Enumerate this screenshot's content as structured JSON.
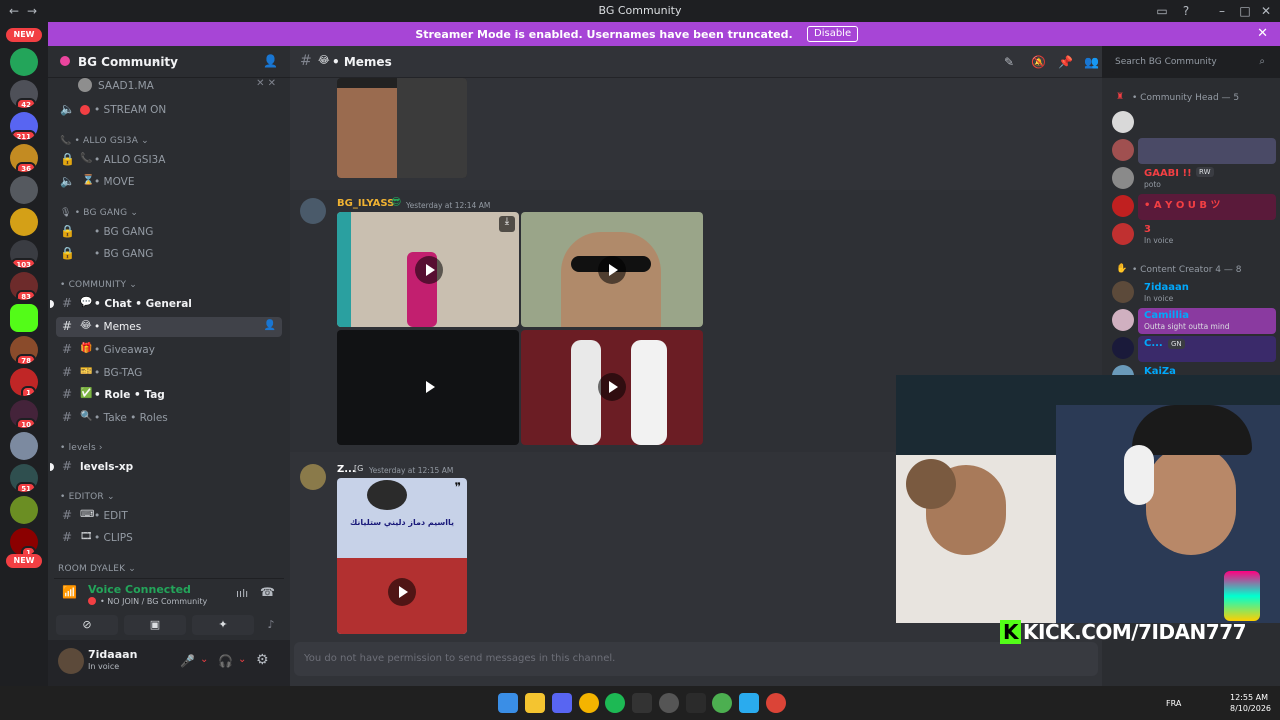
{
  "window": {
    "title": "BG Community"
  },
  "banner": {
    "text": "Streamer Mode is enabled. Usernames have been truncated.",
    "disable_label": "Disable"
  },
  "rail": {
    "new_top": "NEW",
    "new_bottom": "NEW",
    "badges": [
      "42",
      "211",
      "36",
      "103",
      "83",
      "78",
      "1",
      "10",
      "51",
      "1"
    ]
  },
  "guild": {
    "name": "BG Community"
  },
  "channels": [
    {
      "id": "saad",
      "label": "SAAD1.MA",
      "icon": "avatar"
    },
    {
      "id": "stream-on",
      "label": "• STREAM ON",
      "icon": "speaker-icon"
    },
    {
      "id": "cat-allo",
      "label": "• ALLO GSI3A",
      "icon": "category"
    },
    {
      "id": "allo",
      "label": "• ALLO GSI3A",
      "icon": "lock-icon"
    },
    {
      "id": "move",
      "label": "• MOVE",
      "icon": "speaker-icon"
    },
    {
      "id": "cat-bggang",
      "label": "• BG GANG",
      "icon": "category"
    },
    {
      "id": "bggang1",
      "label": "• BG GANG",
      "icon": "lock-icon"
    },
    {
      "id": "bggang2",
      "label": "• BG GANG",
      "icon": "lock-icon"
    },
    {
      "id": "cat-community",
      "label": "• COMMUNITY",
      "icon": "category"
    },
    {
      "id": "chat",
      "label": "• Chat • General",
      "icon": "hash-icon"
    },
    {
      "id": "memes",
      "label": "• Memes",
      "icon": "hash-icon"
    },
    {
      "id": "giveaway",
      "label": "• Giveaway",
      "icon": "hash-icon"
    },
    {
      "id": "bgtag",
      "label": "• BG-TAG",
      "icon": "hash-icon"
    },
    {
      "id": "roletag",
      "label": "• Role • Tag",
      "icon": "hash-icon"
    },
    {
      "id": "takeroles",
      "label": "• Take • Roles",
      "icon": "hash-icon"
    },
    {
      "id": "cat-levels",
      "label": "• levels",
      "icon": "category"
    },
    {
      "id": "levelsxp",
      "label": "levels-xp",
      "icon": "hash-icon"
    },
    {
      "id": "cat-editor",
      "label": "• EDITOR",
      "icon": "category"
    },
    {
      "id": "edit",
      "label": "• EDIT",
      "icon": "hash-icon"
    },
    {
      "id": "clips",
      "label": "• CLIPS",
      "icon": "hash-icon"
    },
    {
      "id": "cat-room",
      "label": "ROOM DYALEK",
      "icon": "category"
    }
  ],
  "voice": {
    "status": "Voice Connected",
    "sub": "• NO JOIN / BG Community"
  },
  "user": {
    "name": "7idaaan",
    "status": "In voice"
  },
  "channel": {
    "name": "• Memes"
  },
  "search": {
    "placeholder": "Search BG Community"
  },
  "messages": [
    {
      "author": "BG_ILYASS",
      "timestamp": "Yesterday at 12:14 AM",
      "color": "#f0b232"
    },
    {
      "author": "Z...",
      "timestamp": "Yesterday at 12:15 AM",
      "color": "#ffffff"
    }
  ],
  "meme_overlay": {
    "caption": "يااسيم دماز دليني ستليانك"
  },
  "composer": {
    "placeholder": "You do not have permission to send messages in this channel."
  },
  "members": {
    "groups": [
      {
        "label": "• Community Head — 5"
      },
      {
        "label": "• Content Creator 4 — 8"
      }
    ],
    "list": [
      {
        "name": "",
        "status": "",
        "color": "#ffffff"
      },
      {
        "name": "",
        "status": "",
        "color": "#ffffff"
      },
      {
        "name": "GAABI !!",
        "tag": "RW",
        "status": "poto",
        "color": "#f23f43"
      },
      {
        "name": "• A Y O U B ツ",
        "status": "",
        "color": "#f23f43"
      },
      {
        "name": "3",
        "status": "In voice",
        "color": "#f23f43"
      },
      {
        "name": "7idaaan",
        "status": "In voice",
        "color": "#00a8fc"
      },
      {
        "name": "Camillia",
        "status": "Outta sight outta mind",
        "color": "#00a8fc"
      },
      {
        "name": "C...",
        "tag": "GN",
        "status": "",
        "color": "#00a8fc"
      },
      {
        "name": "KaiZa",
        "status": "",
        "color": "#00a8fc"
      }
    ]
  },
  "overlay": {
    "kick_text": "KICK.COM/7IDAN777"
  },
  "taskbar": {
    "lang": "FRA",
    "time": "12:55 AM",
    "date": "8/10/2026"
  },
  "colors": {
    "banner": "#a745d6",
    "green": "#23a55a",
    "red": "#f23f43"
  }
}
